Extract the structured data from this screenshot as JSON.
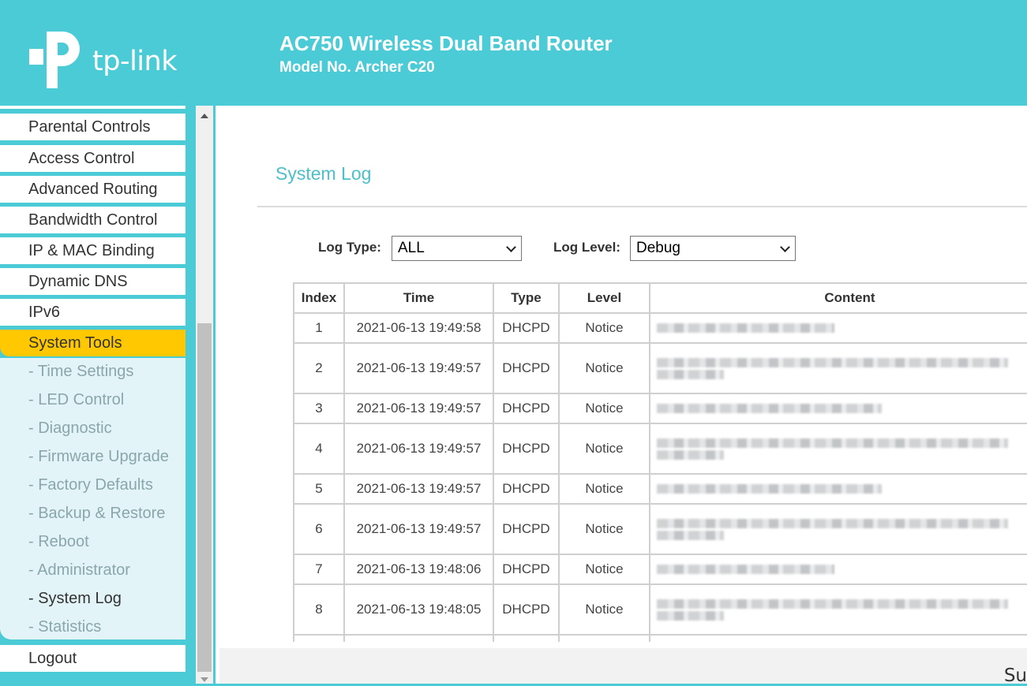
{
  "header": {
    "brand": "tp-link",
    "title": "AC750 Wireless Dual Band Router",
    "model": "Model No. Archer C20",
    "color": "#4acbd6"
  },
  "sidebar": {
    "items": [
      {
        "label": "Parental Controls"
      },
      {
        "label": "Access Control"
      },
      {
        "label": "Advanced Routing"
      },
      {
        "label": "Bandwidth Control"
      },
      {
        "label": "IP & MAC Binding"
      },
      {
        "label": "Dynamic DNS"
      },
      {
        "label": "IPv6"
      },
      {
        "label": "System Tools",
        "active": true
      }
    ],
    "sub_items": [
      {
        "label": "- Time Settings"
      },
      {
        "label": "- LED Control"
      },
      {
        "label": "- Diagnostic"
      },
      {
        "label": "- Firmware Upgrade"
      },
      {
        "label": "- Factory Defaults"
      },
      {
        "label": "- Backup & Restore"
      },
      {
        "label": "- Reboot"
      },
      {
        "label": "- Administrator"
      },
      {
        "label": "- System Log",
        "current": true
      },
      {
        "label": "- Statistics"
      }
    ],
    "logout": "Logout",
    "active_color": "#ffc800"
  },
  "main": {
    "page_title": "System Log",
    "log_type_label": "Log Type:",
    "log_type_value": "ALL",
    "log_level_label": "Log Level:",
    "log_level_value": "Debug",
    "table": {
      "headers": [
        "Index",
        "Time",
        "Type",
        "Level",
        "Content"
      ],
      "rows": [
        {
          "index": "1",
          "time": "2021-06-13 19:49:58",
          "type": "DHCPD",
          "level": "Notice",
          "content": "[redacted]"
        },
        {
          "index": "2",
          "time": "2021-06-13 19:49:57",
          "type": "DHCPD",
          "level": "Notice",
          "content": "[redacted]"
        },
        {
          "index": "3",
          "time": "2021-06-13 19:49:57",
          "type": "DHCPD",
          "level": "Notice",
          "content": "[redacted]"
        },
        {
          "index": "4",
          "time": "2021-06-13 19:49:57",
          "type": "DHCPD",
          "level": "Notice",
          "content": "[redacted]"
        },
        {
          "index": "5",
          "time": "2021-06-13 19:49:57",
          "type": "DHCPD",
          "level": "Notice",
          "content": "[redacted]"
        },
        {
          "index": "6",
          "time": "2021-06-13 19:49:57",
          "type": "DHCPD",
          "level": "Notice",
          "content": "[redacted]"
        },
        {
          "index": "7",
          "time": "2021-06-13 19:48:06",
          "type": "DHCPD",
          "level": "Notice",
          "content": "[redacted]"
        },
        {
          "index": "8",
          "time": "2021-06-13 19:48:05",
          "type": "DHCPD",
          "level": "Notice",
          "content": "[redacted]"
        }
      ]
    }
  },
  "footer": {
    "text": "Su"
  }
}
